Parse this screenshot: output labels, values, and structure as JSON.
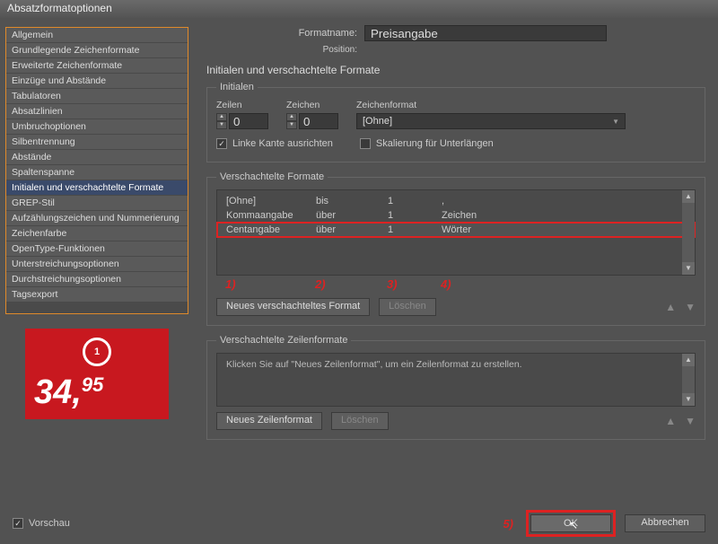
{
  "window": {
    "title": "Absatzformatoptionen"
  },
  "sidebar": {
    "items": [
      "Allgemein",
      "Grundlegende Zeichenformate",
      "Erweiterte Zeichenformate",
      "Einzüge und Abstände",
      "Tabulatoren",
      "Absatzlinien",
      "Umbruchoptionen",
      "Silbentrennung",
      "Abstände",
      "Spaltenspanne",
      "Initialen und verschachtelte Formate",
      "GREP-Stil",
      "Aufzählungszeichen und Nummerierung",
      "Zeichenfarbe",
      "OpenType-Funktionen",
      "Unterstreichungsoptionen",
      "Durchstreichungsoptionen",
      "Tagsexport"
    ],
    "selected_index": 10
  },
  "preview": {
    "badge": "1",
    "whole": "34,",
    "cents": "95"
  },
  "header": {
    "formatname_label": "Formatname:",
    "formatname_value": "Preisangabe",
    "position_label": "Position:",
    "section_title": "Initialen und verschachtelte Formate"
  },
  "initialen": {
    "legend": "Initialen",
    "zeilen_label": "Zeilen",
    "zeilen_value": "0",
    "zeichen_label": "Zeichen",
    "zeichen_value": "0",
    "format_label": "Zeichenformat",
    "format_value": "[Ohne]",
    "align_left_label": "Linke Kante ausrichten",
    "align_left_checked": true,
    "scale_label": "Skalierung für Unterlängen",
    "scale_checked": false
  },
  "nested": {
    "legend": "Verschachtelte Formate",
    "rows": [
      {
        "style": "[Ohne]",
        "through": "bis",
        "count": "1",
        "unit": ","
      },
      {
        "style": "Kommaangabe",
        "through": "über",
        "count": "1",
        "unit": "Zeichen"
      },
      {
        "style": "Centangabe",
        "through": "über",
        "count": "1",
        "unit": "Wörter"
      }
    ],
    "annotations": [
      "1)",
      "2)",
      "3)",
      "4)"
    ],
    "add_btn": "Neues verschachteltes Format",
    "delete_btn": "Löschen"
  },
  "lines": {
    "legend": "Verschachtelte Zeilenformate",
    "hint": "Klicken Sie auf \"Neues Zeilenformat\", um ein Zeilenformat zu erstellen.",
    "add_btn": "Neues Zeilenformat",
    "delete_btn": "Löschen"
  },
  "footer": {
    "preview_label": "Vorschau",
    "preview_checked": true,
    "annotation5": "5)",
    "ok": "OK",
    "cancel": "Abbrechen"
  }
}
